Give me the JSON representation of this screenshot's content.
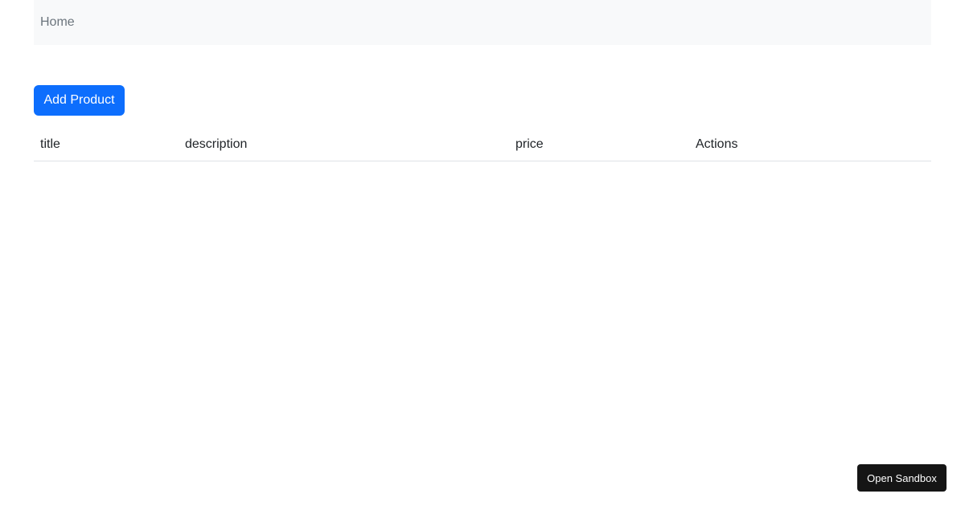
{
  "breadcrumb": {
    "items": [
      {
        "label": "Home"
      }
    ]
  },
  "actions": {
    "add_product_label": "Add Product"
  },
  "table": {
    "columns": [
      "title",
      "description",
      "price",
      "Actions"
    ],
    "rows": []
  },
  "sandbox": {
    "label": "Open Sandbox"
  },
  "colors": {
    "primary": "#0d6efd",
    "breadcrumb_bg": "#f8f9fa",
    "breadcrumb_text": "#6c757d",
    "sandbox_bg": "#151515"
  }
}
